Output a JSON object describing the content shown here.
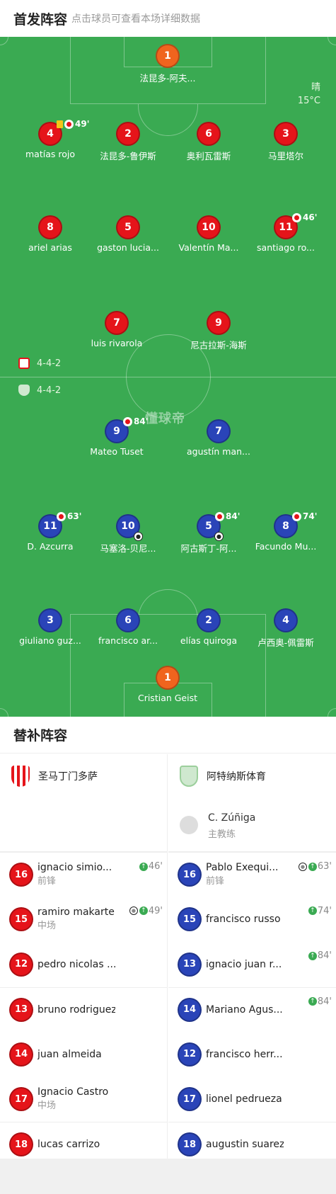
{
  "header": {
    "title": "首发阵容",
    "subtitle": "点击球员可查看本场详细数据"
  },
  "weather": {
    "condition": "晴",
    "temp": "15°C"
  },
  "watermark": "懂球帝",
  "home_formation": "4-4-2",
  "away_formation": "4-4-2",
  "home_players": [
    {
      "no": "1",
      "name": "法昆多-阿夫...",
      "gk": true
    },
    {
      "no": "4",
      "name": "matías rojo",
      "event": "49'",
      "yellow": true,
      "sub_off": true
    },
    {
      "no": "2",
      "name": "法昆多-鲁伊斯"
    },
    {
      "no": "6",
      "name": "奥利瓦雷斯"
    },
    {
      "no": "3",
      "name": "马里塔尔"
    },
    {
      "no": "8",
      "name": "ariel arias"
    },
    {
      "no": "5",
      "name": "gaston lucia..."
    },
    {
      "no": "10",
      "name": "Valentín Ma..."
    },
    {
      "no": "11",
      "name": "santiago ro...",
      "event": "46'",
      "sub_off": true
    },
    {
      "no": "7",
      "name": "luis rivarola"
    },
    {
      "no": "9",
      "name": "尼古拉斯-海斯"
    }
  ],
  "away_players": [
    {
      "no": "9",
      "name": "Mateo Tuset",
      "event": "84'",
      "sub_off": true
    },
    {
      "no": "7",
      "name": "agustín man..."
    },
    {
      "no": "11",
      "name": "D. Azcurra",
      "event": "63'",
      "sub_off": true
    },
    {
      "no": "10",
      "name": "马塞洛-贝尼...",
      "goal": true
    },
    {
      "no": "5",
      "name": "阿古斯丁-阿...",
      "event": "84'",
      "sub_off": true,
      "goal": true
    },
    {
      "no": "8",
      "name": "Facundo Mu...",
      "event": "74'",
      "sub_off": true
    },
    {
      "no": "3",
      "name": "giuliano guz..."
    },
    {
      "no": "6",
      "name": "francisco ar..."
    },
    {
      "no": "2",
      "name": "elías quiroga"
    },
    {
      "no": "4",
      "name": "卢西奥-佩雷斯"
    },
    {
      "no": "1",
      "name": "Cristian Geist",
      "gk": true
    }
  ],
  "subs": {
    "title": "替补阵容",
    "home_team": "圣马丁门多萨",
    "away_team": "阿特纳斯体育",
    "away_coach": {
      "name": "C. Zúñiga",
      "role": "主教练"
    },
    "home": [
      {
        "no": "16",
        "name": "ignacio simio...",
        "pos": "前锋",
        "evt": "46'"
      },
      {
        "no": "15",
        "name": "ramiro makarte",
        "pos": "中场",
        "evt": "49'",
        "goal": true
      },
      {
        "no": "12",
        "name": "pedro nicolas ...",
        "pos": ""
      },
      {
        "no": "13",
        "name": "bruno rodriguez",
        "pos": ""
      },
      {
        "no": "14",
        "name": "juan almeida",
        "pos": ""
      },
      {
        "no": "17",
        "name": "Ignacio Castro",
        "pos": "中场"
      },
      {
        "no": "18",
        "name": "lucas carrizo",
        "pos": ""
      }
    ],
    "away": [
      {
        "no": "16",
        "name": "Pablo Exequi...",
        "pos": "前锋",
        "evt": "63'",
        "goal": true
      },
      {
        "no": "15",
        "name": "francisco russo",
        "pos": "",
        "evt": "74'"
      },
      {
        "no": "13",
        "name": "ignacio juan r...",
        "pos": "",
        "evt": "84'"
      },
      {
        "no": "14",
        "name": "Mariano Agus...",
        "pos": "",
        "evt": "84'"
      },
      {
        "no": "12",
        "name": "francisco herr...",
        "pos": ""
      },
      {
        "no": "17",
        "name": "lionel pedrueza",
        "pos": ""
      },
      {
        "no": "18",
        "name": "augustin suarez",
        "pos": ""
      }
    ]
  },
  "colors": {
    "pitch": "#3aaa52",
    "home": "#e5141a",
    "away": "#2a44b8",
    "gk": "#f0641e"
  }
}
